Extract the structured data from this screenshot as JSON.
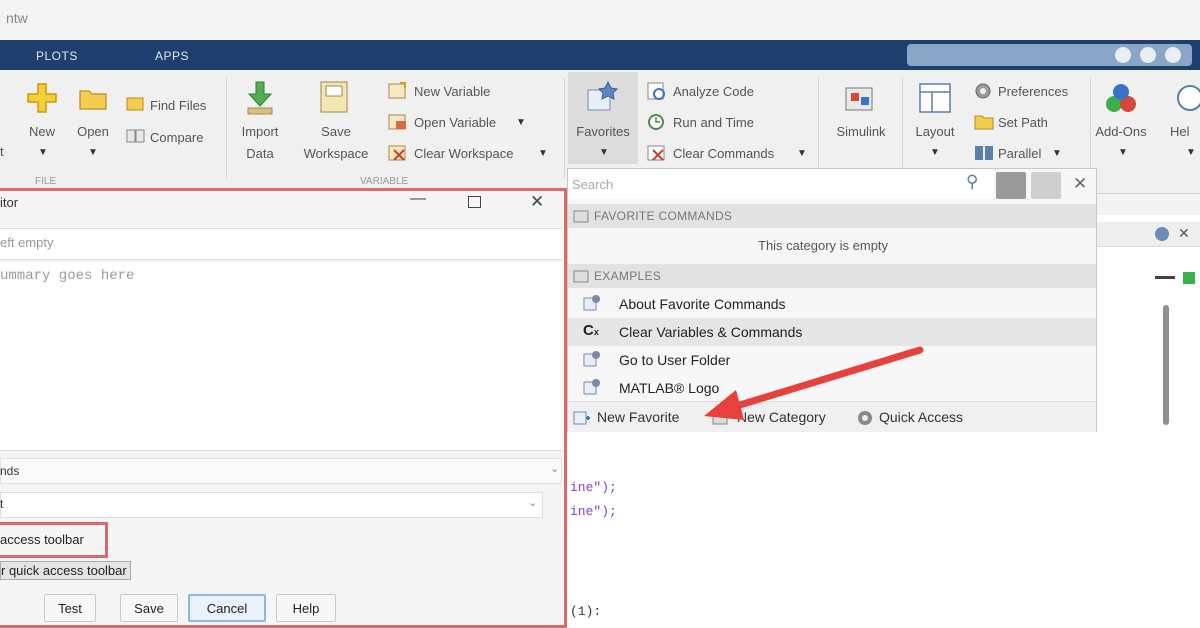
{
  "window": {
    "title": "ntw"
  },
  "tabs": [
    {
      "label": "PLOTS"
    },
    {
      "label": "APPS"
    }
  ],
  "ribbon": {
    "file": {
      "new_label": "New",
      "open_label": "Open",
      "find_files_label": "Find Files",
      "compare_label": "Compare",
      "section": "FILE"
    },
    "variable": {
      "import_label": "Import",
      "import_label2": "Data",
      "save_label": "Save",
      "save_label2": "Workspace",
      "new_variable_label": "New Variable",
      "open_variable_label": "Open Variable",
      "clear_workspace_label": "Clear Workspace",
      "section": "VARIABLE"
    },
    "code": {
      "favorites_label": "Favorites",
      "analyze_code_label": "Analyze Code",
      "run_and_time_label": "Run and Time",
      "clear_commands_label": "Clear Commands"
    },
    "simulink_label": "Simulink",
    "environment": {
      "layout_label": "Layout",
      "preferences_label": "Preferences",
      "set_path_label": "Set Path",
      "parallel_label": "Parallel",
      "addons_label": "Add-Ons",
      "help_label": "Hel"
    },
    "left_partial_label": "t"
  },
  "dialog": {
    "title": "itor",
    "label_placeholder": "eft empty",
    "code_placeholder": "ummary goes here",
    "category_value": "nds",
    "icon_value": "t",
    "quick_access_label": "access toolbar",
    "quick_access_label2": "r quick access toolbar",
    "buttons": {
      "test": "Test",
      "save": "Save",
      "cancel": "Cancel",
      "help": "Help"
    }
  },
  "favorites_panel": {
    "search_placeholder": "Search",
    "favorite_commands_header": "FAVORITE COMMANDS",
    "empty_text": "This category is empty",
    "examples_header": "EXAMPLES",
    "items": [
      {
        "label": "About Favorite Commands"
      },
      {
        "label": "Clear Variables & Commands"
      },
      {
        "label": "Go to User Folder"
      },
      {
        "label": "MATLAB® Logo"
      }
    ],
    "footer": {
      "new_favorite": "New Favorite",
      "new_category": "New Category",
      "quick_access": "Quick Access"
    }
  },
  "code_fragments": [
    "ine\");",
    "ine\");"
  ],
  "code_line": "(1):",
  "colors": {
    "tab_strip": "#1f3f6e",
    "highlight": "#d9696e",
    "arrow": "#e8403a"
  }
}
